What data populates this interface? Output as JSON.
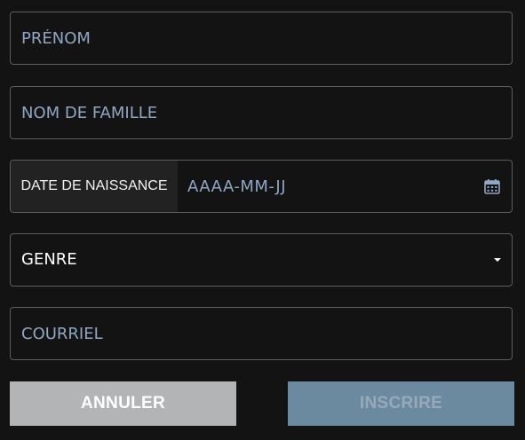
{
  "form": {
    "prenom": {
      "placeholder": "PRÉNOM",
      "value": ""
    },
    "nom_de_famille": {
      "placeholder": "NOM DE FAMILLE",
      "value": ""
    },
    "date_de_naissance": {
      "prefix_label": "DATE DE NAISSANCE",
      "placeholder": "AAAA-MM-JJ",
      "value": "",
      "icon": "calendar-icon"
    },
    "genre": {
      "selected": "GENRE",
      "icon": "caret-down-icon"
    },
    "courriel": {
      "placeholder": "COURRIEL",
      "value": ""
    }
  },
  "buttons": {
    "annuler_label": "ANNULER",
    "inscrire_label": "INSCRIRE"
  },
  "colors": {
    "background": "#131313",
    "border": "#5d5d5d",
    "placeholder": "#8fa7c2",
    "cancel_button": "#b3b4b6",
    "submit_button_disabled": "#6b8aa0"
  }
}
